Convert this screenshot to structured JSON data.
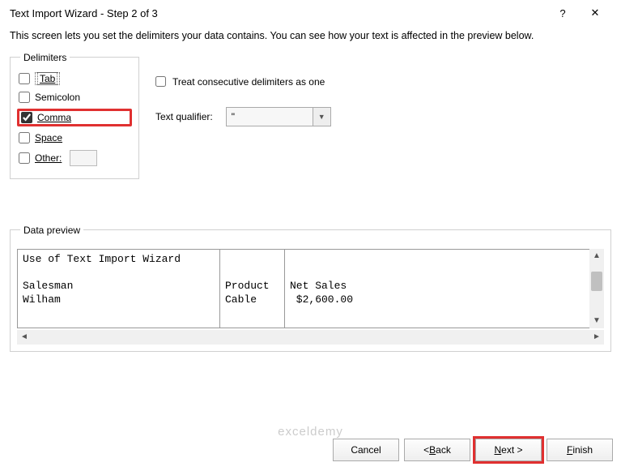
{
  "titlebar": {
    "title": "Text Import Wizard - Step 2 of 3",
    "help": "?",
    "close": "✕"
  },
  "description": "This screen lets you set the delimiters your data contains.  You can see how your text is affected in the preview below.",
  "delimiters": {
    "legend": "Delimiters",
    "tab": "Tab",
    "semicolon": "Semicolon",
    "comma": "Comma",
    "space": "Space",
    "other": "Other:"
  },
  "options": {
    "treat": "Treat consecutive delimiters as one",
    "text_qualifier_label": "Text qualifier:",
    "text_qualifier_value": "\""
  },
  "preview": {
    "legend": "Data preview",
    "col1": "Use of Text Import Wizard\n\nSalesman\nWilham",
    "col2": "\n\nProduct\nCable",
    "col3": "\n\nNet Sales\n $2,600.00"
  },
  "buttons": {
    "cancel": "Cancel",
    "back": "< Back",
    "next": "Next >",
    "finish": "Finish"
  },
  "watermark": "exceldemy"
}
